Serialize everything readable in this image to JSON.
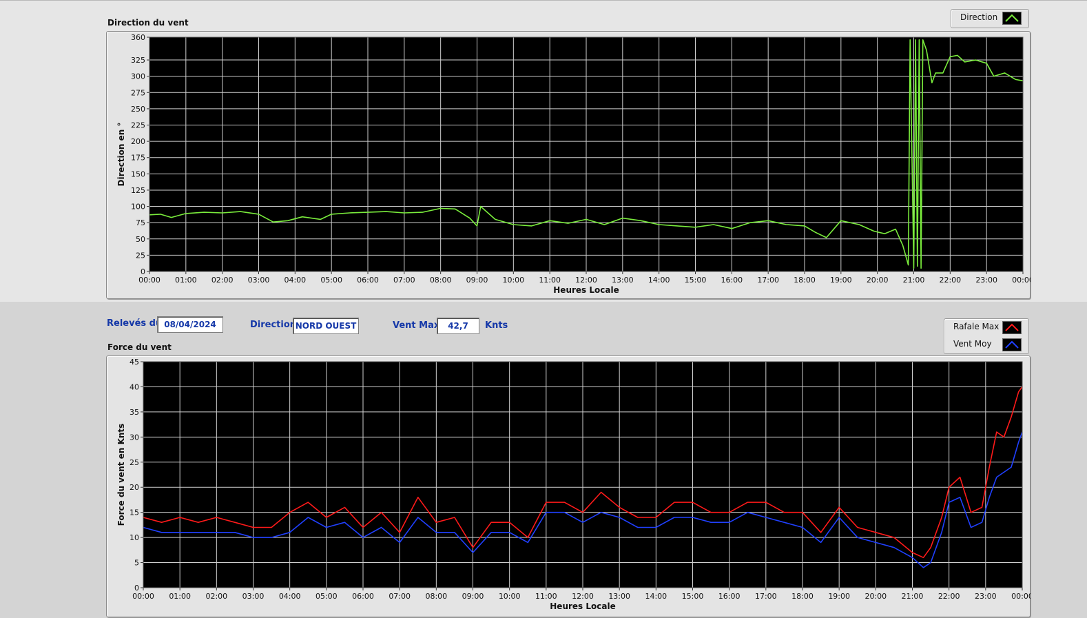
{
  "colors": {
    "plot_background": "#000000",
    "grid": "#d0d0d0",
    "direction_line": "#7aec3c",
    "gust_line": "#ff1a1a",
    "mean_line": "#2040ff",
    "field_text": "#1538a8"
  },
  "info_bar": {
    "date_label": "Relevés du",
    "date_value": "08/04/2024",
    "direction_label": "Direction",
    "direction_value": "NORD OUEST",
    "max_label": "Vent Max",
    "max_value": "42,7",
    "max_unit": "Knts"
  },
  "chart_data": [
    {
      "type": "line",
      "title": "Direction du vent",
      "xlabel": "Heures Locale",
      "ylabel": "Direction en °",
      "xlim": [
        0,
        24
      ],
      "ylim": [
        0,
        360
      ],
      "grid": true,
      "legend_placement": "top-right",
      "x_ticks": [
        "00:00",
        "01:00",
        "02:00",
        "03:00",
        "04:00",
        "05:00",
        "06:00",
        "07:00",
        "08:00",
        "09:00",
        "10:00",
        "11:00",
        "12:00",
        "13:00",
        "14:00",
        "15:00",
        "16:00",
        "17:00",
        "18:00",
        "19:00",
        "20:00",
        "21:00",
        "22:00",
        "23:00",
        "00:00"
      ],
      "y_ticks": [
        "0",
        "25",
        "50",
        "75",
        "100",
        "125",
        "150",
        "175",
        "200",
        "225",
        "250",
        "275",
        "300",
        "325",
        "360"
      ],
      "y_tick_values": [
        0,
        25,
        50,
        75,
        100,
        125,
        150,
        175,
        200,
        225,
        250,
        275,
        300,
        325,
        360
      ],
      "series": [
        {
          "name": "Direction",
          "color": "#7aec3c",
          "x": [
            0,
            0.3,
            0.6,
            1.0,
            1.5,
            2.0,
            2.5,
            3.0,
            3.4,
            3.8,
            4.2,
            4.7,
            5.0,
            5.5,
            6.0,
            6.5,
            7.0,
            7.5,
            8.0,
            8.4,
            8.8,
            9.0,
            9.1,
            9.5,
            10.0,
            10.5,
            11.0,
            11.5,
            12.0,
            12.5,
            13.0,
            13.5,
            14.0,
            14.5,
            15.0,
            15.5,
            16.0,
            16.5,
            17.0,
            17.5,
            18.0,
            18.3,
            18.6,
            19.0,
            19.5,
            19.9,
            20.2,
            20.5,
            20.7,
            20.85,
            20.9,
            21.0,
            21.05,
            21.1,
            21.15,
            21.2,
            21.25,
            21.35,
            21.5,
            21.6,
            21.8,
            22.0,
            22.2,
            22.4,
            22.7,
            23.0,
            23.2,
            23.5,
            23.8,
            24.0
          ],
          "y": [
            87,
            88,
            83,
            89,
            91,
            90,
            92,
            88,
            76,
            78,
            84,
            80,
            88,
            90,
            91,
            92,
            90,
            91,
            97,
            96,
            82,
            70,
            100,
            80,
            72,
            70,
            78,
            74,
            80,
            72,
            82,
            78,
            72,
            70,
            68,
            72,
            66,
            75,
            78,
            72,
            70,
            60,
            52,
            78,
            72,
            62,
            58,
            65,
            40,
            10,
            356,
            5,
            356,
            8,
            356,
            5,
            356,
            340,
            290,
            305,
            305,
            330,
            332,
            322,
            325,
            320,
            300,
            305,
            295,
            293
          ]
        }
      ]
    },
    {
      "type": "line",
      "title": "Force du vent",
      "xlabel": "Heures Locale",
      "ylabel": "Force du vent en Knts",
      "xlim": [
        0,
        24
      ],
      "ylim": [
        0,
        45
      ],
      "grid": true,
      "legend_placement": "top-right",
      "x_ticks": [
        "00:00",
        "01:00",
        "02:00",
        "03:00",
        "04:00",
        "05:00",
        "06:00",
        "07:00",
        "08:00",
        "09:00",
        "10:00",
        "11:00",
        "12:00",
        "13:00",
        "14:00",
        "15:00",
        "16:00",
        "17:00",
        "18:00",
        "19:00",
        "20:00",
        "21:00",
        "22:00",
        "23:00",
        "00:00"
      ],
      "y_ticks": [
        "0",
        "5",
        "10",
        "15",
        "20",
        "25",
        "30",
        "35",
        "40",
        "45"
      ],
      "y_tick_values": [
        0,
        5,
        10,
        15,
        20,
        25,
        30,
        35,
        40,
        45
      ],
      "series": [
        {
          "name": "Rafale Max",
          "color": "#ff1a1a",
          "x": [
            0,
            0.5,
            1.0,
            1.5,
            2.0,
            2.5,
            3.0,
            3.5,
            4.0,
            4.5,
            5.0,
            5.5,
            6.0,
            6.5,
            7.0,
            7.5,
            8.0,
            8.5,
            9.0,
            9.5,
            10.0,
            10.5,
            11.0,
            11.5,
            12.0,
            12.5,
            13.0,
            13.5,
            14.0,
            14.5,
            15.0,
            15.5,
            16.0,
            16.5,
            17.0,
            17.5,
            18.0,
            18.5,
            19.0,
            19.5,
            20.0,
            20.5,
            21.0,
            21.3,
            21.5,
            21.8,
            22.0,
            22.3,
            22.6,
            22.9,
            23.1,
            23.3,
            23.5,
            23.7,
            23.9,
            24.0
          ],
          "y": [
            14,
            13,
            14,
            13,
            14,
            13,
            12,
            12,
            15,
            17,
            14,
            16,
            12,
            15,
            11,
            18,
            13,
            14,
            8,
            13,
            13,
            10,
            17,
            17,
            15,
            19,
            16,
            14,
            14,
            17,
            17,
            15,
            15,
            17,
            17,
            15,
            15,
            11,
            16,
            12,
            11,
            10,
            7,
            6,
            8,
            14,
            20,
            22,
            15,
            16,
            24,
            31,
            30,
            34,
            39,
            40
          ]
        },
        {
          "name": "Vent Moy",
          "color": "#2040ff",
          "x": [
            0,
            0.5,
            1.0,
            1.5,
            2.0,
            2.5,
            3.0,
            3.5,
            4.0,
            4.5,
            5.0,
            5.5,
            6.0,
            6.5,
            7.0,
            7.5,
            8.0,
            8.5,
            9.0,
            9.5,
            10.0,
            10.5,
            11.0,
            11.5,
            12.0,
            12.5,
            13.0,
            13.5,
            14.0,
            14.5,
            15.0,
            15.5,
            16.0,
            16.5,
            17.0,
            17.5,
            18.0,
            18.5,
            19.0,
            19.5,
            20.0,
            20.5,
            21.0,
            21.3,
            21.5,
            21.8,
            22.0,
            22.3,
            22.6,
            22.9,
            23.1,
            23.3,
            23.5,
            23.7,
            23.9,
            24.0
          ],
          "y": [
            12,
            11,
            11,
            11,
            11,
            11,
            10,
            10,
            11,
            14,
            12,
            13,
            10,
            12,
            9,
            14,
            11,
            11,
            7,
            11,
            11,
            9,
            15,
            15,
            13,
            15,
            14,
            12,
            12,
            14,
            14,
            13,
            13,
            15,
            14,
            13,
            12,
            9,
            14,
            10,
            9,
            8,
            6,
            4,
            5,
            11,
            17,
            18,
            12,
            13,
            18,
            22,
            23,
            24,
            29,
            31
          ]
        }
      ]
    }
  ]
}
